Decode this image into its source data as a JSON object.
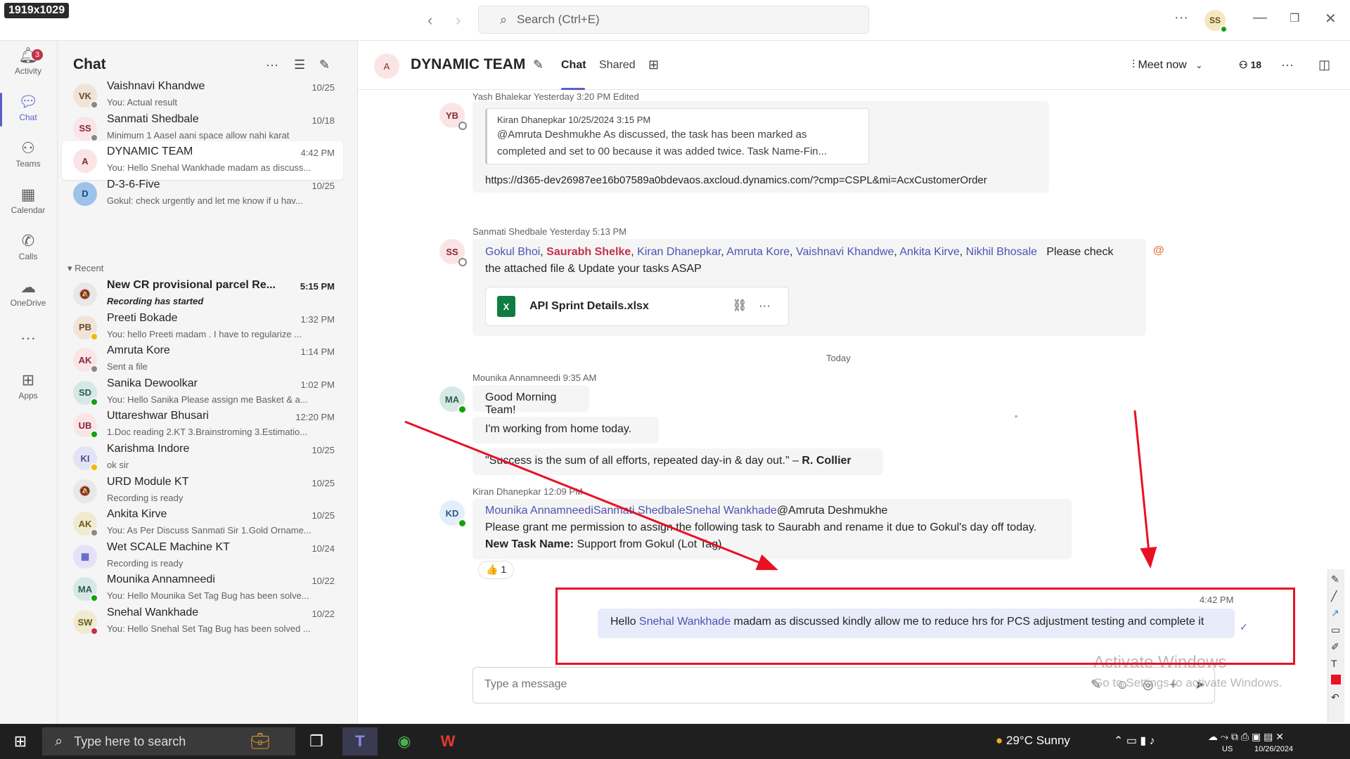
{
  "badge": "1919x1029",
  "titlebar": {
    "search_placeholder": "Search (Ctrl+E)",
    "user_initials": "SS"
  },
  "rail": {
    "activity": "Activity",
    "activity_count": "3",
    "chat": "Chat",
    "teams": "Teams",
    "calendar": "Calendar",
    "calls": "Calls",
    "onedrive": "OneDrive",
    "apps": "Apps"
  },
  "chatlist": {
    "title": "Chat",
    "recent_label": "Recent",
    "pinned": [
      {
        "initials": "VK",
        "name": "Vaishnavi Khandwe",
        "time": "10/25",
        "preview": "You: Actual result",
        "bg": "#f0e4d6",
        "fg": "#6b4b2b"
      },
      {
        "initials": "SS",
        "name": "Sanmati Shedbale",
        "time": "10/18",
        "preview": "Minimum 1 Aasel aani space allow nahi karat",
        "bg": "#fbe4e6",
        "fg": "#842b36"
      },
      {
        "initials": "A",
        "name": "DYNAMIC TEAM",
        "time": "4:42 PM",
        "preview": "You: Hello Snehal Wankhade madam as discuss...",
        "bg": "#fbe4e6",
        "fg": "#842b36"
      },
      {
        "initials": "D",
        "name": "D-3-6-Five",
        "time": "10/25",
        "preview": "Gokul: check urgently and let me know if u hav...",
        "bg": "#9ec3ea",
        "fg": "#1e4a7a"
      }
    ],
    "recent": [
      {
        "initials": "🔕",
        "name": "New CR provisional parcel Re...",
        "time": "5:15 PM",
        "preview": "Recording has started",
        "bg": "#e8e8e8",
        "fg": "#616161",
        "bold": true
      },
      {
        "initials": "PB",
        "name": "Preeti Bokade",
        "time": "1:32 PM",
        "preview": "You: hello Preeti madam . I have to regularize ...",
        "bg": "#f0e4d6",
        "fg": "#6b4b2b"
      },
      {
        "initials": "AK",
        "name": "Amruta Kore",
        "time": "1:14 PM",
        "preview": "Sent a file",
        "bg": "#fbe4e6",
        "fg": "#842b36"
      },
      {
        "initials": "SD",
        "name": "Sanika Dewoolkar",
        "time": "1:02 PM",
        "preview": "You: Hello Sanika Please assign me  Basket & a...",
        "bg": "#d6e8e4",
        "fg": "#2b5c54"
      },
      {
        "initials": "UB",
        "name": "Uttareshwar Bhusari",
        "time": "12:20 PM",
        "preview": "1.Doc reading 2.KT 3.Brainstroming 3.Estimatio...",
        "bg": "#fbe4e6",
        "fg": "#842b36"
      },
      {
        "initials": "KI",
        "name": "Karishma Indore",
        "time": "10/25",
        "preview": "ok sir",
        "bg": "#e4e2f5",
        "fg": "#4f4a8a"
      },
      {
        "initials": "🔕",
        "name": "URD Module KT",
        "time": "10/25",
        "preview": "Recording is ready",
        "bg": "#e8e8e8",
        "fg": "#616161"
      },
      {
        "initials": "AK",
        "name": "Ankita Kirve",
        "time": "10/25",
        "preview": "You: As Per Discuss Sanmati Sir  1.Gold Orname...",
        "bg": "#f0ead0",
        "fg": "#6b5b1b"
      },
      {
        "initials": "▦",
        "name": "Wet SCALE Machine KT",
        "time": "10/24",
        "preview": "Recording is ready",
        "bg": "#e4e2f5",
        "fg": "#5b5fc7"
      },
      {
        "initials": "MA",
        "name": "Mounika Annamneedi",
        "time": "10/22",
        "preview": "You: Hello Mounika Set Tag Bug has been solve...",
        "bg": "#d6e8e4",
        "fg": "#2b5c54"
      },
      {
        "initials": "SW",
        "name": "Snehal Wankhade",
        "time": "10/22",
        "preview": "You: Hello Snehal Set Tag Bug has been solved ...",
        "bg": "#f0ead0",
        "fg": "#6b5b1b"
      }
    ]
  },
  "channel": {
    "initials": "A",
    "title": "DYNAMIC TEAM",
    "tabs": [
      "Chat",
      "Shared"
    ],
    "meet_now": "Meet now",
    "participants": "18"
  },
  "messages": {
    "m1_sender": "Yash Bhalekar  Yesterday 3:20 PM  Edited",
    "m1_avatar": "YB",
    "m1_quote_header": "Kiran Dhanepkar  10/25/2024 3:15 PM",
    "m1_quote_line1": "@Amruta Deshmukhe As discussed, the task has been marked as",
    "m1_quote_line2": "completed and set to 00 because it was added twice. Task Name-Fin...",
    "m1_link": "https://d365-dev26987ee16b07589a0bdevaos.axcloud.dynamics.com/?cmp=CSPL&mi=AcxCustomerOrder",
    "m2_sender": "Sanmati Shedbale  Yesterday 5:13 PM",
    "m2_avatar": "SS",
    "m2_mentions": [
      "Gokul Bhoi",
      "Saurabh Shelke",
      "Kiran Dhanepkar",
      "Amruta Kore",
      "Vaishnavi Khandwe",
      "Ankita Kirve",
      "Nikhil Bhosale"
    ],
    "m2_text_tail": "Please check",
    "m2_text_line2": "the attached file & Update your tasks ASAP",
    "m2_file": "API Sprint Details.xlsx",
    "divider": "Today",
    "m3_sender": "Mounika Annamneedi  9:35 AM",
    "m3_avatar": "MA",
    "m3_msg1": "Good Morning Team!",
    "m3_msg2": "I'm working from home today.",
    "m3_msg3": "\"Success is the sum of all efforts, repeated day-in & day out.\" –",
    "m3_msg3_author": "R. Collier",
    "m4_sender": "Kiran Dhanepkar  12:09 PM",
    "m4_avatar": "KD",
    "m4_mentions": "Mounika AnnamneediSanmati ShedbaleSnehal Wankhade",
    "m4_at": "@Amruta Deshmukhe",
    "m4_line2": "Please grant me permission to assign the following task to Saurabh and rename it due to Gokul's day off today.",
    "m4_bold": "New Task Name:",
    "m4_tail": "Support from Gokul (Lot Tag)",
    "m4_reaction": "👍",
    "m4_reaction_count": "1",
    "m5_time": "4:42 PM",
    "m5_pre": "Hello",
    "m5_mention": "Snehal Wankhade",
    "m5_post": "madam as discussed kindly allow me to reduce hrs for PCS adjustment testing and complete it"
  },
  "compose": {
    "placeholder": "Type a message"
  },
  "watermark": {
    "line1": "Activate Windows",
    "line2": "Go to Settings to activate Windows."
  },
  "taskbar": {
    "search": "Type here to search",
    "weather": "29°C  Sunny",
    "lang": "US",
    "date": "10/26/2024"
  },
  "colors": {
    "accent": "#5b5fc7",
    "mention": "#4f52b2",
    "annotation": "#e81123",
    "teams_purple": "#5b5fc7"
  }
}
